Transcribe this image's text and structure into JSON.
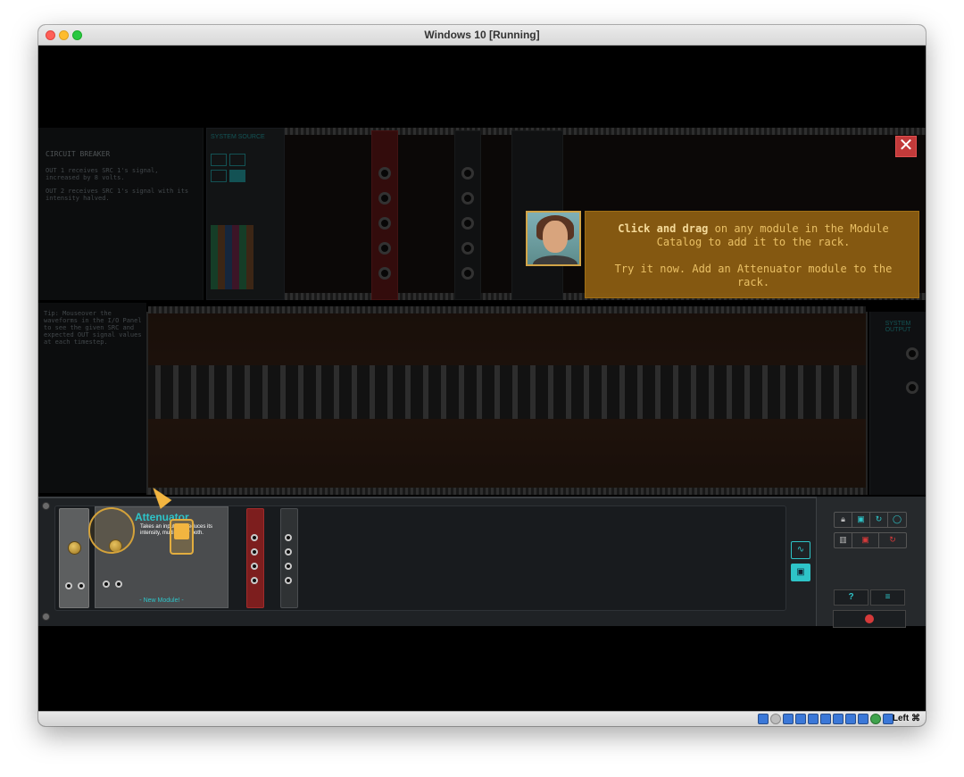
{
  "window": {
    "title": "Windows 10 [Running]"
  },
  "game": {
    "circuit_breaker": {
      "title": "CIRCUIT BREAKER",
      "line1": "OUT 1 receives SRC 1's signal, increased by 8 volts.",
      "line2": "OUT 2 receives SRC 1's signal with its intensity halved."
    },
    "system_source_label": "SYSTEM SOURCE",
    "system_output_label": "SYSTEM OUTPUT",
    "tip_text": "Tip: Mouseover the waveforms in the I/O Panel to see the given SRC and expected OUT signal values at each timestep.",
    "tutorial": {
      "line1_bold": "Click and drag",
      "line1_rest": " on any module in the Module Catalog to add it to the rack.",
      "line2": "Try it now. Add an Attenuator module to the rack.",
      "close_label": "✕"
    },
    "catalog": {
      "new_module_title": "Attenuator",
      "new_module_desc": "Takes an input and reduces its intensity, multiplier or both.",
      "new_module_footer": "- New Module! -"
    },
    "controls": {
      "help_label": "?",
      "menu_label": "≡"
    }
  },
  "statusbar": {
    "host_key": "Left ⌘"
  },
  "colors": {
    "accent_cyan": "#2ec4c8",
    "tutorial_bg": "#8a5c12",
    "tutorial_text": "#f3c86a",
    "close_red": "#c23a3a"
  }
}
